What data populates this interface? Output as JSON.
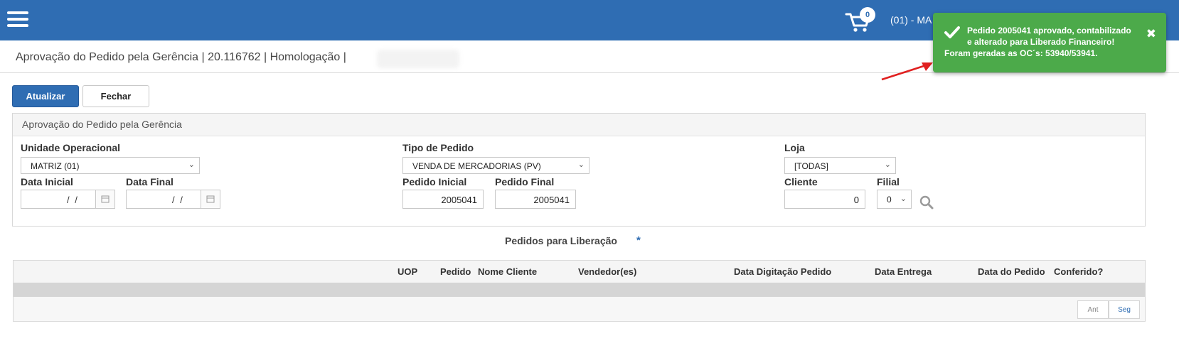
{
  "header": {
    "cart_count": "0",
    "user_label": "(01) - MA"
  },
  "page": {
    "title": "Aprovação do Pedido pela Gerência | 20.116762 | Homologação |"
  },
  "toolbar": {
    "refresh_label": "Atualizar",
    "close_label": "Fechar"
  },
  "filters": {
    "panel_title": "Aprovação do Pedido pela Gerência",
    "unidade_label": "Unidade Operacional",
    "unidade_value": "MATRIZ (01)",
    "tipo_label": "Tipo de Pedido",
    "tipo_value": "VENDA DE MERCADORIAS (PV)",
    "loja_label": "Loja",
    "loja_value": "[TODAS]",
    "data_inicial_label": "Data Inicial",
    "data_final_label": "Data Final",
    "date_placeholder": "/ /",
    "pedido_inicial_label": "Pedido Inicial",
    "pedido_inicial_value": "2005041",
    "pedido_final_label": "Pedido Final",
    "pedido_final_value": "2005041",
    "cliente_label": "Cliente",
    "cliente_value": "0",
    "filial_label": "Filial",
    "filial_value": "0"
  },
  "table": {
    "title": "Pedidos para Liberação",
    "required_mark": "*",
    "columns": [
      "UOP",
      "Pedido",
      "Nome Cliente",
      "Vendedor(es)",
      "Data Digitação Pedido",
      "Data Entrega",
      "Data do Pedido",
      "Conferido?"
    ],
    "pager_prev": "Ant",
    "pager_next": "Seg"
  },
  "toast": {
    "line1": "Pedido 2005041 aprovado, contabilizado",
    "line2": "e alterado para Liberado Financeiro!",
    "line3": "Foram geradas as OC´s: 53940/53941.",
    "close_glyph": "✖",
    "color": "#4caa4a"
  },
  "theme": {
    "primary": "#2f6db3",
    "annotation_arrow": "#e02020"
  }
}
